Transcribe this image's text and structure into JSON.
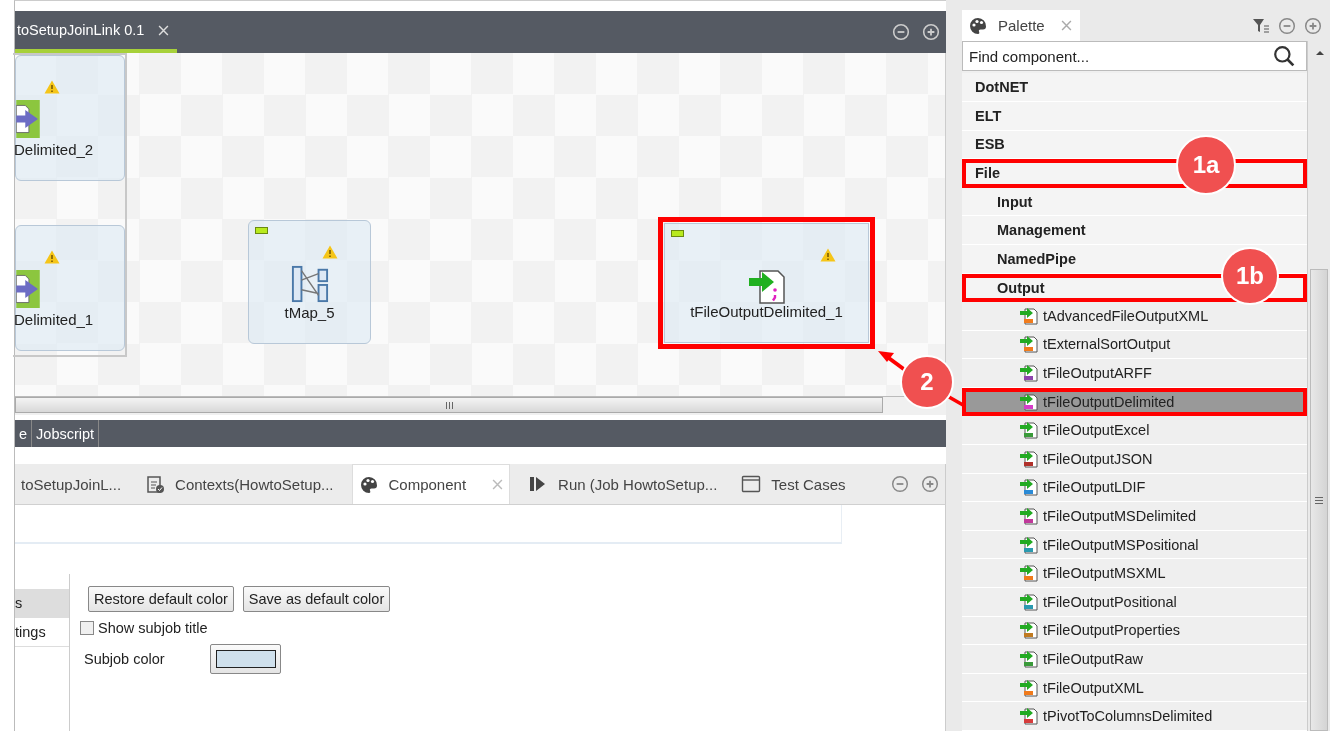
{
  "editor": {
    "tab_title": "toSetupJoinLink 0.1",
    "nodes": [
      {
        "label": "Delimited_2",
        "highlighted": false
      },
      {
        "label": "Delimited_1",
        "highlighted": false
      },
      {
        "label": "tMap_5",
        "highlighted": false
      },
      {
        "label": "tFileOutputDelimited_1",
        "highlighted": true
      }
    ]
  },
  "editor_tabs": [
    {
      "label": "e",
      "selected": false
    },
    {
      "label": "Jobscript",
      "selected": false
    }
  ],
  "view_tabs": [
    {
      "label": "toSetupJoinL...",
      "selected": false
    },
    {
      "label": "Contexts(HowtoSetup...",
      "selected": false
    },
    {
      "label": "Component",
      "selected": true
    },
    {
      "label": "Run (Job HowtoSetup...",
      "selected": false
    },
    {
      "label": "Test Cases",
      "selected": false
    }
  ],
  "component_view": {
    "side_tabs": [
      {
        "label": "s",
        "selected": true
      },
      {
        "label": "tings",
        "selected": false
      }
    ],
    "buttons": [
      "Restore default color",
      "Save as default color"
    ],
    "show_subjob_title": {
      "label": "Show subjob title",
      "checked": false
    },
    "subjob_color": {
      "label": "Subjob color",
      "color": "#cfe0ec"
    }
  },
  "palette": {
    "title": "Palette",
    "search": {
      "placeholder": "Find component..."
    },
    "categories": [
      {
        "label": "DotNET",
        "kind": "category",
        "selected": false,
        "highlighted": false
      },
      {
        "label": "ELT",
        "kind": "category",
        "selected": false,
        "highlighted": false
      },
      {
        "label": "ESB",
        "kind": "category",
        "selected": false,
        "highlighted": false
      },
      {
        "label": "File",
        "kind": "category",
        "selected": false,
        "highlighted": true,
        "children": [
          {
            "label": "Input",
            "kind": "category",
            "selected": false,
            "highlighted": false
          },
          {
            "label": "Management",
            "kind": "category",
            "selected": false,
            "highlighted": false
          },
          {
            "label": "NamedPipe",
            "kind": "category",
            "selected": false,
            "highlighted": false
          },
          {
            "label": "Output",
            "kind": "category",
            "selected": false,
            "highlighted": true,
            "children": [
              {
                "label": "tAdvancedFileOutputXML",
                "kind": "component",
                "selected": false,
                "highlighted": false
              },
              {
                "label": "tExternalSortOutput",
                "kind": "component",
                "selected": false,
                "highlighted": false
              },
              {
                "label": "tFileOutputARFF",
                "kind": "component",
                "selected": false,
                "highlighted": false
              },
              {
                "label": "tFileOutputDelimited",
                "kind": "component",
                "selected": true,
                "highlighted": true
              },
              {
                "label": "tFileOutputExcel",
                "kind": "component",
                "selected": false,
                "highlighted": false
              },
              {
                "label": "tFileOutputJSON",
                "kind": "component",
                "selected": false,
                "highlighted": false
              },
              {
                "label": "tFileOutputLDIF",
                "kind": "component",
                "selected": false,
                "highlighted": false
              },
              {
                "label": "tFileOutputMSDelimited",
                "kind": "component",
                "selected": false,
                "highlighted": false
              },
              {
                "label": "tFileOutputMSPositional",
                "kind": "component",
                "selected": false,
                "highlighted": false
              },
              {
                "label": "tFileOutputMSXML",
                "kind": "component",
                "selected": false,
                "highlighted": false
              },
              {
                "label": "tFileOutputPositional",
                "kind": "component",
                "selected": false,
                "highlighted": false
              },
              {
                "label": "tFileOutputProperties",
                "kind": "component",
                "selected": false,
                "highlighted": false
              },
              {
                "label": "tFileOutputRaw",
                "kind": "component",
                "selected": false,
                "highlighted": false
              },
              {
                "label": "tFileOutputXML",
                "kind": "component",
                "selected": false,
                "highlighted": false
              },
              {
                "label": "tPivotToColumnsDelimited",
                "kind": "component",
                "selected": false,
                "highlighted": false
              }
            ]
          }
        ]
      }
    ]
  },
  "callouts": [
    {
      "label": "1a"
    },
    {
      "label": "1b"
    },
    {
      "label": "2"
    }
  ]
}
